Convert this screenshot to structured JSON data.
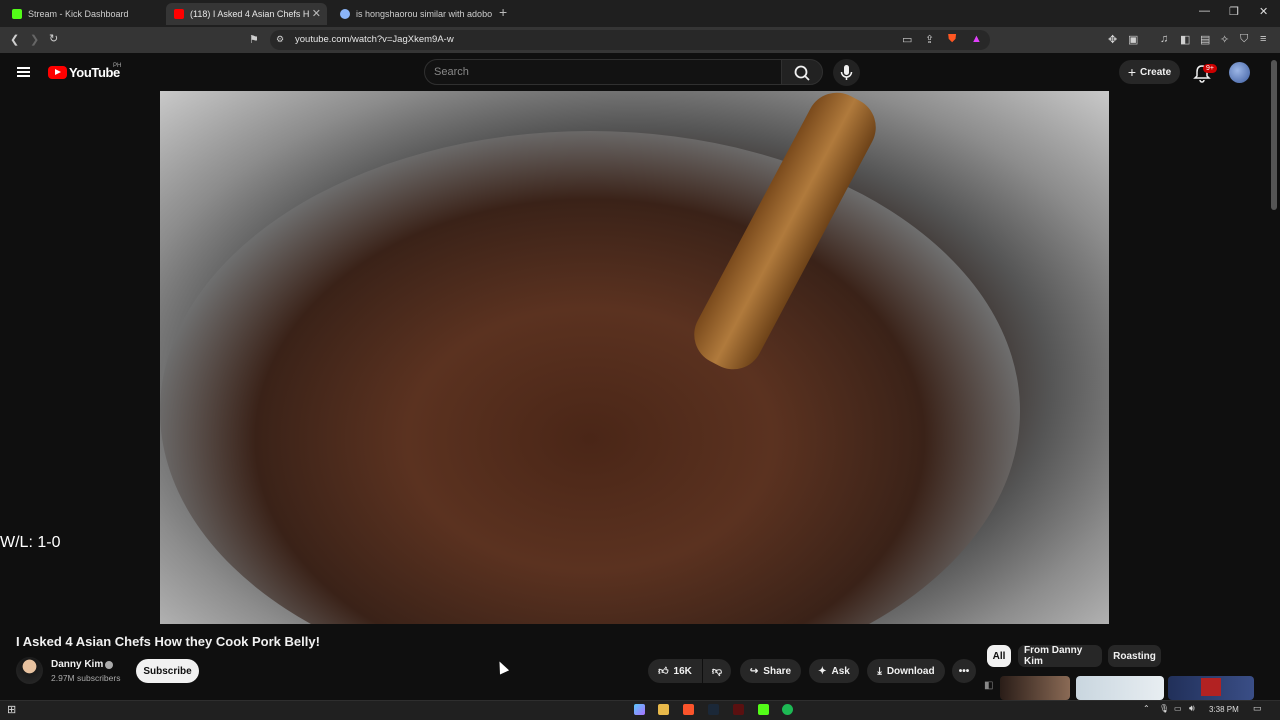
{
  "browser": {
    "tabs": [
      {
        "title": "Stream - Kick Dashboard",
        "favicon_color": "#53fc18"
      },
      {
        "title": "(118) I Asked 4 Asian Chefs H",
        "favicon_color": "#ff0000"
      },
      {
        "title": "is hongshaorou similar with adobo -",
        "favicon_color": "#8ab4f8"
      }
    ],
    "url": "youtube.com/watch?v=JagXkem9A-w"
  },
  "header": {
    "logo_text": "YouTube",
    "country_code": "PH",
    "search_placeholder": "Search",
    "create_label": "Create",
    "notification_count": "9+"
  },
  "video": {
    "overlay_text": "W/L: 1-0",
    "title": "I Asked 4 Asian Chefs How they Cook Pork Belly!",
    "channel_name": "Danny Kim",
    "subscribers": "2.97M subscribers",
    "subscribe_label": "Subscribe",
    "likes": "16K",
    "share_label": "Share",
    "ask_label": "Ask",
    "download_label": "Download"
  },
  "chips": [
    "All",
    "From Danny Kim",
    "Roasting"
  ],
  "taskbar": {
    "time": "3:38 PM"
  }
}
